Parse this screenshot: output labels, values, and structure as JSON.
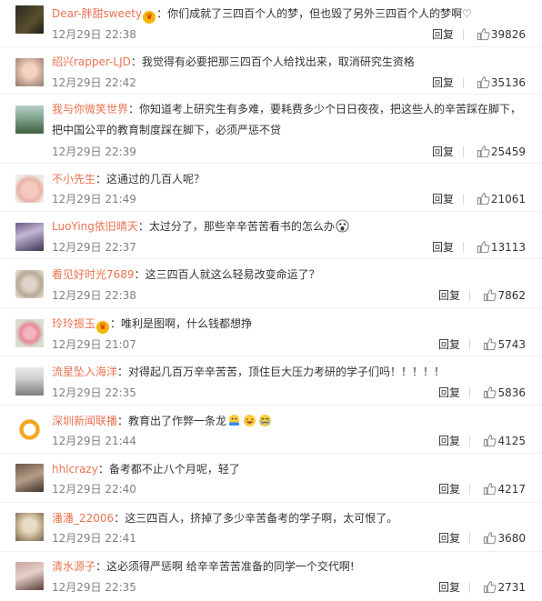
{
  "labels": {
    "reply": "回复",
    "separator": "："
  },
  "comments": [
    {
      "user": "Dear-胖甜sweety",
      "vip": true,
      "text": "你们成就了三四百个人的梦，但也毁了另外三四百个人的梦啊♡",
      "time": "12月29日 22:38",
      "likes": "39826",
      "avatar": "avatar-dark"
    },
    {
      "user": "绍兴rapper-LJD",
      "vip": false,
      "text": "我觉得有必要把那三四百个人给找出来，取消研究生资格",
      "time": "12月29日 22:42",
      "likes": "35136",
      "avatar": "avatar-baby"
    },
    {
      "user": "我与你微笑世界",
      "vip": false,
      "text": "你知道考上研究生有多难，要耗费多少个日日夜夜，把这些人的辛苦踩在脚下，把中国公平的教育制度踩在脚下，必须严惩不贷",
      "time": "12月29日 22:39",
      "likes": "25459",
      "avatar": "avatar-scenery"
    },
    {
      "user": "不小先生",
      "vip": false,
      "text": "这通过的几百人呢？",
      "time": "12月29日 21:49",
      "likes": "21061",
      "avatar": "avatar-pig"
    },
    {
      "user": "LuoYing依旧晴天",
      "vip": false,
      "text": "太过分了，那些辛辛苦苦看书的怎么办",
      "time": "12月29日 22:37",
      "likes": "13113",
      "avatar": "avatar-girl",
      "emoji": [
        "scream"
      ]
    },
    {
      "user": "看见好时光7689",
      "vip": false,
      "text": "这三四百人就这么轻易改变命运了？",
      "time": "12月29日 22:38",
      "likes": "7862",
      "avatar": "avatar-sketch"
    },
    {
      "user": "玲玲振玉",
      "vip": true,
      "text": "唯利是图啊，什么钱都想挣",
      "time": "12月29日 21:07",
      "likes": "5743",
      "avatar": "avatar-flower"
    },
    {
      "user": "流星坠入海洋",
      "vip": false,
      "text": "对得起几百万辛辛苦苦，顶住巨大压力考研的学子们吗！！！！！",
      "time": "12月29日 22:35",
      "likes": "5836",
      "avatar": "avatar-man"
    },
    {
      "user": "深圳新闻联播",
      "vip": false,
      "text": "教育出了作弊一条龙",
      "time": "12月29日 21:44",
      "likes": "4125",
      "avatar": "avatar-logo",
      "emoji": [
        "hug",
        "laugh",
        "cry"
      ]
    },
    {
      "user": "hhlcrazy",
      "vip": false,
      "text": "备考都不止八个月呢，轻了",
      "time": "12月29日 22:40",
      "likes": "4217",
      "avatar": "avatar-mug"
    },
    {
      "user": "潘潘_22006",
      "vip": false,
      "text": "这三四百人，挤掉了多少辛苦备考的学子啊，太可恨了。",
      "time": "12月29日 22:41",
      "likes": "3680",
      "avatar": "avatar-dog"
    },
    {
      "user": "清水源子",
      "vip": false,
      "text": "这必须得严惩啊 给辛辛苦苦准备的同学一个交代啊!",
      "time": "12月29日 22:35",
      "likes": "2731",
      "avatar": "avatar-woman"
    }
  ],
  "colors": {
    "username": "#eb7350",
    "meta": "#808080",
    "text": "#333333",
    "divider": "#f0f0f0"
  }
}
